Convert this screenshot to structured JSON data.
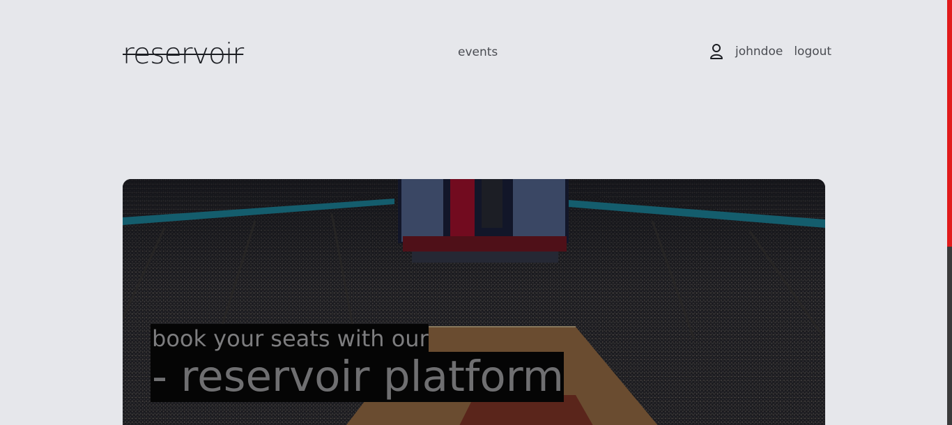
{
  "header": {
    "logo": "reservoir",
    "nav_events": "events",
    "username": "johndoe",
    "logout": "logout",
    "user_icon": "user-icon"
  },
  "hero": {
    "subtitle": "book your seats with our",
    "title": "- reservoir platform",
    "image": "basketball-arena-crowd"
  },
  "colors": {
    "background": "#e6e7eb",
    "text": "#4a4c52",
    "scrollbar_thumb": "#e11b1b",
    "scrollbar_track": "#3a3a3a"
  }
}
